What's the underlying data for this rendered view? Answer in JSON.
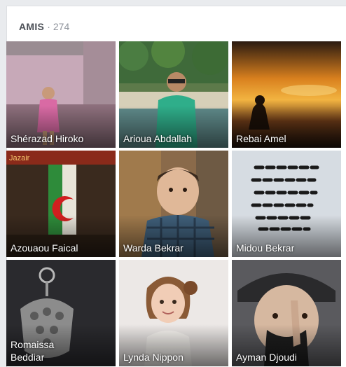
{
  "section": {
    "title": "AMIS",
    "separator": "·",
    "count": "274"
  },
  "friends": [
    {
      "name": "Shérazad Hiroko"
    },
    {
      "name": "Arioua Abdallah"
    },
    {
      "name": "Rebai Amel"
    },
    {
      "name": "Azouaou Faical"
    },
    {
      "name": "Warda Bekrar"
    },
    {
      "name": "Midou Bekrar"
    },
    {
      "name": "Romaissa Beddiar"
    },
    {
      "name": "Lynda Nippon"
    },
    {
      "name": "Ayman Djoudi"
    }
  ],
  "photo_text": {
    "flag_banner": "Jazair"
  }
}
